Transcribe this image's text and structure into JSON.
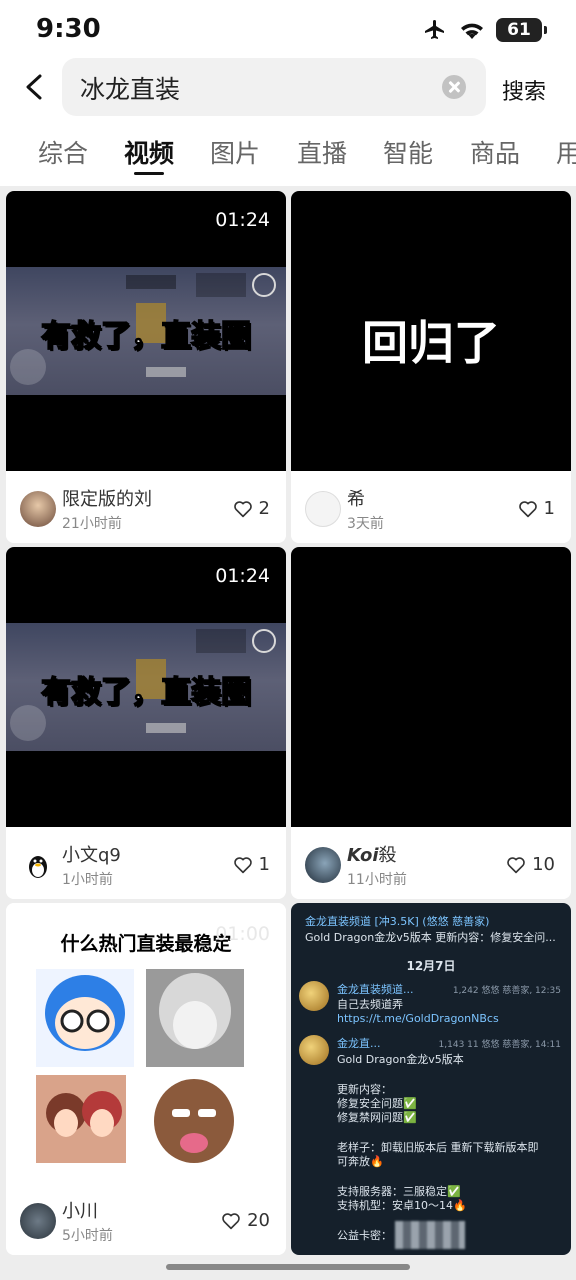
{
  "status": {
    "time": "9:30",
    "battery": "61"
  },
  "search": {
    "query": "冰龙直装",
    "button": "搜索"
  },
  "tabs": [
    "综合",
    "视频",
    "图片",
    "直播",
    "智能",
    "商品",
    "用"
  ],
  "cards": [
    {
      "duration": "01:24",
      "caption": "有救了，直装圈",
      "author": "限定版的刘",
      "ago": "21小时前",
      "likes": "2"
    },
    {
      "text": "回归了",
      "author": "希",
      "ago": "3天前",
      "likes": "1"
    },
    {
      "duration": "01:24",
      "caption": "有救了，直装圈",
      "author": "小文q9",
      "ago": "1小时前",
      "likes": "1"
    },
    {
      "author_italic": "Koi",
      "author_rest": "殺",
      "ago": "11小时前",
      "likes": "10"
    },
    {
      "meme_title": "什么热门直装最稳定",
      "ghost_time": "01:00",
      "author": "小川",
      "ago": "5小时前",
      "likes": "20"
    },
    {
      "tg_title": "金龙直装频道 [冲3.5K] (悠悠 慈善家)",
      "tg_sub": "Gold Dragon金龙v5版本 更新内容：修复安全问...",
      "tg_date": "12月7日",
      "msg1_name": "金龙直装频道...",
      "msg1_stat": "1,242 悠悠 慈善家, 12:35",
      "msg1_text": "自己去频道弄",
      "msg1_link": "https://t.me/GoldDragonNBcs",
      "msg2_name": "金龙直...",
      "msg2_stat": "1,143 11 悠悠 慈善家, 14:11",
      "msg2_lines": [
        "Gold Dragon金龙v5版本",
        "",
        "更新内容：",
        "修复安全问题✅",
        "修复禁网问题✅",
        "",
        "老样子：卸载旧版本后 重新下载新版本即",
        "可奔放🔥",
        "",
        "支持服务器：三服稳定✅",
        "支持机型：安卓10～14🔥",
        "",
        "公益卡密："
      ]
    }
  ]
}
